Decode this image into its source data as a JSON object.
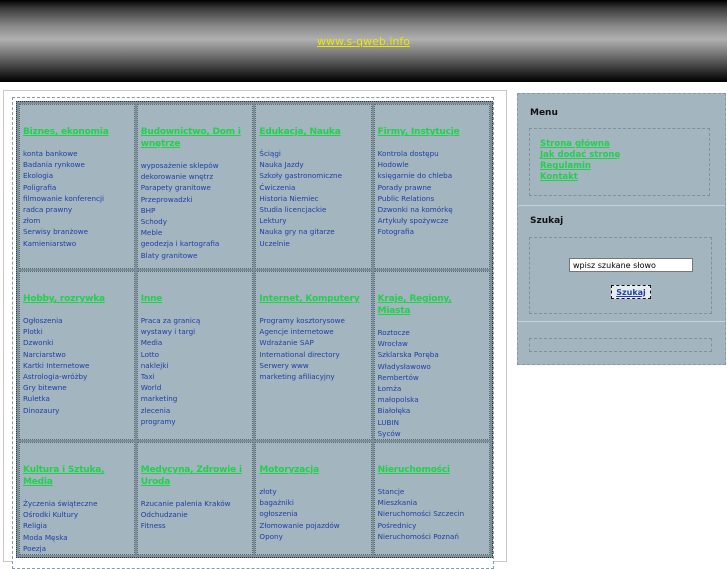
{
  "header": {
    "site_link": "www.s-qweb.info"
  },
  "categories": [
    {
      "title": "Biznes, ekonomia",
      "links": [
        "konta bankowe",
        "Badania rynkowe",
        "Ekologia",
        "Poligrafia",
        "filmowanie konferencji",
        "radca prawny",
        "złom",
        "Serwisy branżowe",
        "Kamieniarstwo"
      ]
    },
    {
      "title": "Budownictwo, Dom i wnętrze",
      "links": [
        "wyposażenie sklepów",
        "dekorowanie wnętrz",
        "Parapety granitowe",
        "Przeprowadzki",
        "BHP",
        "Schody",
        "Meble",
        "geodezja i kartografia",
        "Blaty granitowe"
      ]
    },
    {
      "title": "Edukacja, Nauka",
      "links": [
        "Ściągi",
        "Nauka Jazdy",
        "Szkoły gastronomiczne",
        "Ćwiczenia",
        "Historia Niemiec",
        "Studia licencjackie",
        "Lektury",
        "Nauka gry na gitarze",
        "Uczelnie"
      ]
    },
    {
      "title": "Firmy, Instytucje",
      "links": [
        "Kontrola dostępu",
        "Hodowle",
        "księgarnie do chleba",
        "Porady prawne",
        "Public Relations",
        "Dzwonki na komórkę",
        "Artykuły spożywcze",
        "Fotografia"
      ]
    },
    {
      "title": "Hobby, rozrywka",
      "links": [
        "Ogłoszenia",
        "Plotki",
        "Dzwonki",
        "Narciarstwo",
        "Kartki Internetowe",
        "Astrologia-wróżby",
        "Gry bitewne",
        "Ruletka",
        "Dinozaury"
      ]
    },
    {
      "title": "Inne",
      "links": [
        "Praca za granicą",
        "wystawy i targi",
        "Media",
        "Lotto",
        "naklejki",
        "Taxi",
        "World",
        "marketing",
        "zlecenia",
        "programy"
      ]
    },
    {
      "title": "Internet, Komputery",
      "links": [
        "Programy kosztorysowe",
        "Agencje internetowe",
        "Wdrażanie SAP",
        "International directory",
        "Serwery www",
        "marketing afiliacyjny"
      ]
    },
    {
      "title": "Kraje, Regiony, Miasta",
      "links": [
        "Roztocze",
        "Wrocław",
        "Szklarska Poręba",
        "Władysławowo",
        "Rembertów",
        "Łomża",
        "małopolska",
        "Białołęka",
        "LUBIN",
        "Syców"
      ]
    },
    {
      "title": "Kultura i Sztuka, Media",
      "links": [
        "Życzenia świąteczne",
        "Ośrodki Kultury",
        "Religia",
        "Moda Męska",
        "Poezja"
      ]
    },
    {
      "title": "Medycyna, Zdrowie i Uroda",
      "links": [
        "Rzucanie palenia Kraków",
        "Odchudzanie",
        "Fitness"
      ]
    },
    {
      "title": "Motoryzacja",
      "links": [
        "złoty",
        "bagażniki",
        "ogłoszenia",
        "Złomowanie pojazdów",
        "Opony"
      ]
    },
    {
      "title": "Nieruchomości",
      "links": [
        "Stancje",
        "Mieszkania",
        "Nieruchomości Szczecin",
        "Pośrednicy",
        "Nieruchomości Poznań"
      ]
    }
  ],
  "sidebar": {
    "menu_title": "Menu",
    "menu_links": [
      "Strona główna",
      "Jak dodać stronę",
      "Regulamin",
      "Kontakt"
    ],
    "search_title": "Szukaj",
    "search_placeholder": "wpisz szukane słowo",
    "search_button": "Szukaj"
  }
}
